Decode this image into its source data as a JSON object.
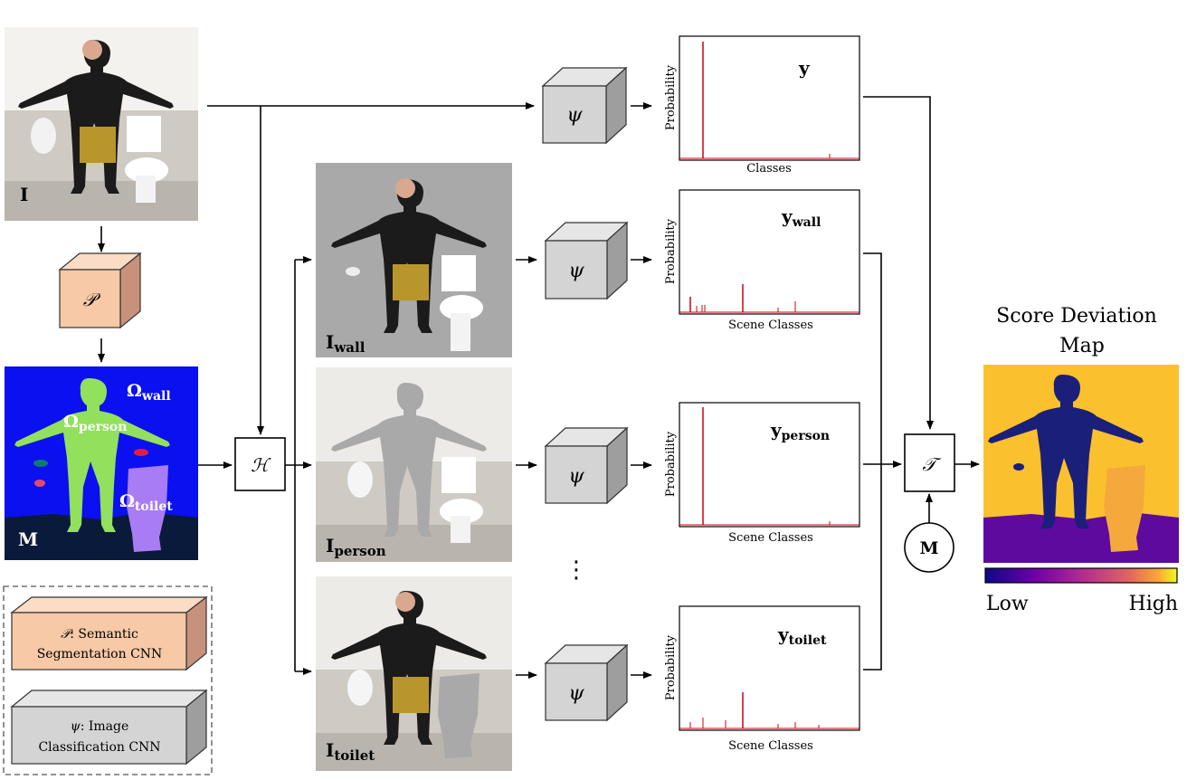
{
  "inputs": {
    "image_label": "I",
    "mask_label": "M",
    "regions": [
      {
        "key": "wall",
        "base": "Ω",
        "sub": "wall"
      },
      {
        "key": "person",
        "base": "Ω",
        "sub": "person"
      },
      {
        "key": "toilet",
        "base": "Ω",
        "sub": "toilet"
      }
    ]
  },
  "modules": {
    "segmentation_symbol": "𝒫",
    "classifier_symbol": "ψ",
    "hiding_symbol": "ℋ",
    "transform_symbol": "𝒯",
    "mask_node_label": "M"
  },
  "masked_images": [
    {
      "base": "I",
      "sub": "wall"
    },
    {
      "base": "I",
      "sub": "person"
    },
    {
      "base": "I",
      "sub": "toilet"
    }
  ],
  "ellipsis": "⋮",
  "charts": [
    {
      "label_base": "y",
      "label_sub": "",
      "xlabel": "Classes",
      "ylabel": "Probability"
    },
    {
      "label_base": "y",
      "label_sub": "wall",
      "xlabel": "Scene Classes",
      "ylabel": "Probability"
    },
    {
      "label_base": "y",
      "label_sub": "person",
      "xlabel": "Scene Classes",
      "ylabel": "Probability"
    },
    {
      "label_base": "y",
      "label_sub": "toilet",
      "xlabel": "Scene Classes",
      "ylabel": "Probability"
    }
  ],
  "output": {
    "title_line1": "Score Deviation",
    "title_line2": "Map",
    "colorbar_low": "Low",
    "colorbar_high": "High"
  },
  "legend": {
    "items": [
      {
        "symbol": "𝒫",
        "line1": ": Semantic",
        "line2": "Segmentation CNN"
      },
      {
        "symbol": "ψ",
        "line1": ": Image",
        "line2": "Classification CNN"
      }
    ]
  },
  "colors": {
    "seg_box": "#f7c9a6",
    "seg_box_top": "#fbdcc4",
    "seg_box_side": "#c8927a",
    "cls_box": "#d4d4d4",
    "cls_box_top": "#e6e6e6",
    "cls_box_side": "#9e9e9e",
    "mask_wall": "#0a10f0",
    "mask_person": "#93e05c",
    "mask_toilet": "#a77cf4",
    "mask_floor": "#0a1a3a",
    "histogram": "#d0000a",
    "map_background": "#fbc02d",
    "map_person": "#1a1f7a",
    "map_floor": "#5e0a9e",
    "map_toilet": "#f5a93c"
  }
}
